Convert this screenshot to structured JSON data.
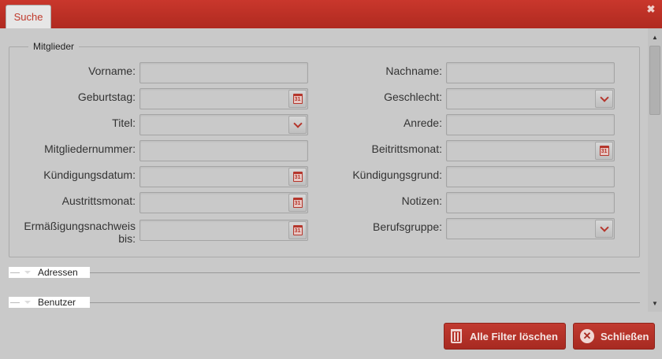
{
  "dialog": {
    "tab_label": "Suche",
    "close_glyph": "✖"
  },
  "members": {
    "legend": "Mitglieder",
    "fields": [
      {
        "label": "Vorname:",
        "value": "",
        "control": "text"
      },
      {
        "label": "Nachname:",
        "value": "",
        "control": "text"
      },
      {
        "label": "Geburtstag:",
        "value": "",
        "control": "date"
      },
      {
        "label": "Geschlecht:",
        "value": "",
        "control": "select"
      },
      {
        "label": "Titel:",
        "value": "",
        "control": "select"
      },
      {
        "label": "Anrede:",
        "value": "",
        "control": "text"
      },
      {
        "label": "Mitgliedernummer:",
        "value": "",
        "control": "text"
      },
      {
        "label": "Beitrittsmonat:",
        "value": "",
        "control": "date"
      },
      {
        "label": "Kündigungsdatum:",
        "value": "",
        "control": "date"
      },
      {
        "label": "Kündigungsgrund:",
        "value": "",
        "control": "text"
      },
      {
        "label": "Austrittsmonat:",
        "value": "",
        "control": "date"
      },
      {
        "label": "Notizen:",
        "value": "",
        "control": "text"
      },
      {
        "label": "Ermäßigungsnachweis bis:",
        "value": "",
        "control": "date"
      },
      {
        "label": "Berufsgruppe:",
        "value": "",
        "control": "select"
      }
    ]
  },
  "sections": {
    "addresses": "Adressen",
    "users": "Benutzer"
  },
  "footer": {
    "clear_label": "Alle Filter löschen",
    "close_label": "Schließen"
  },
  "colors": {
    "accent": "#b5362c",
    "titlebar": "#c0392b",
    "overlay": "#c9c9c9"
  }
}
